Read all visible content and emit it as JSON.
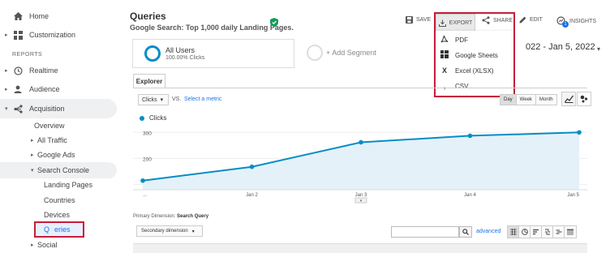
{
  "sidebar": {
    "home": "Home",
    "customization": "Customization",
    "reports_section": "REPORTS",
    "realtime": "Realtime",
    "audience": "Audience",
    "acquisition": "Acquisition",
    "overview": "Overview",
    "all_traffic": "All Traffic",
    "google_ads": "Google Ads",
    "search_console": "Search Console",
    "landing_pages": "Landing Pages",
    "countries": "Countries",
    "devices": "Devices",
    "queries": "eries",
    "social": "Social"
  },
  "header": {
    "title": "Queries",
    "subtitle": "Google Search: Top 1,000 daily Landing Pages."
  },
  "toolbar": {
    "save": "SAVE",
    "export": "EXPORT",
    "share": "SHARE",
    "edit": "EDIT",
    "insights": "INSIGHTS",
    "insights_badge": "1"
  },
  "export_menu": {
    "items": [
      {
        "label": "PDF",
        "icon": "pdf-icon"
      },
      {
        "label": "Google Sheets",
        "icon": "sheets-icon"
      },
      {
        "label": "Excel (XLSX)",
        "icon": "excel-icon"
      },
      {
        "label": "CSV",
        "icon": "csv-icon"
      }
    ]
  },
  "date_range": "022 - Jan 5, 2022",
  "segments": {
    "all_users": "All Users",
    "all_users_pct": "100.00% Clicks",
    "add_segment": "+ Add Segment"
  },
  "explorer": {
    "tab": "Explorer",
    "metric": "Clicks",
    "vs": "VS.",
    "select_metric": "Select a metric",
    "periods": [
      "Day",
      "Week",
      "Month"
    ],
    "active_period": "Day"
  },
  "chart_data": {
    "type": "area",
    "series": [
      {
        "name": "Clicks",
        "values": [
          115,
          168,
          262,
          287,
          300
        ]
      }
    ],
    "x": [
      "",
      "Jan 2",
      "Jan 3",
      "Jan 4",
      "Jan 5"
    ],
    "y_ticks": [
      "300",
      "200",
      "100"
    ],
    "ylim": [
      80,
      335
    ],
    "ellipsis_label": "...",
    "color": "#058dc7"
  },
  "table": {
    "primary_dimension_label": "Primary Dimension:",
    "primary_dimension_value": "Search Query",
    "secondary_dimension": "Secondary dimension",
    "advanced": "advanced"
  }
}
